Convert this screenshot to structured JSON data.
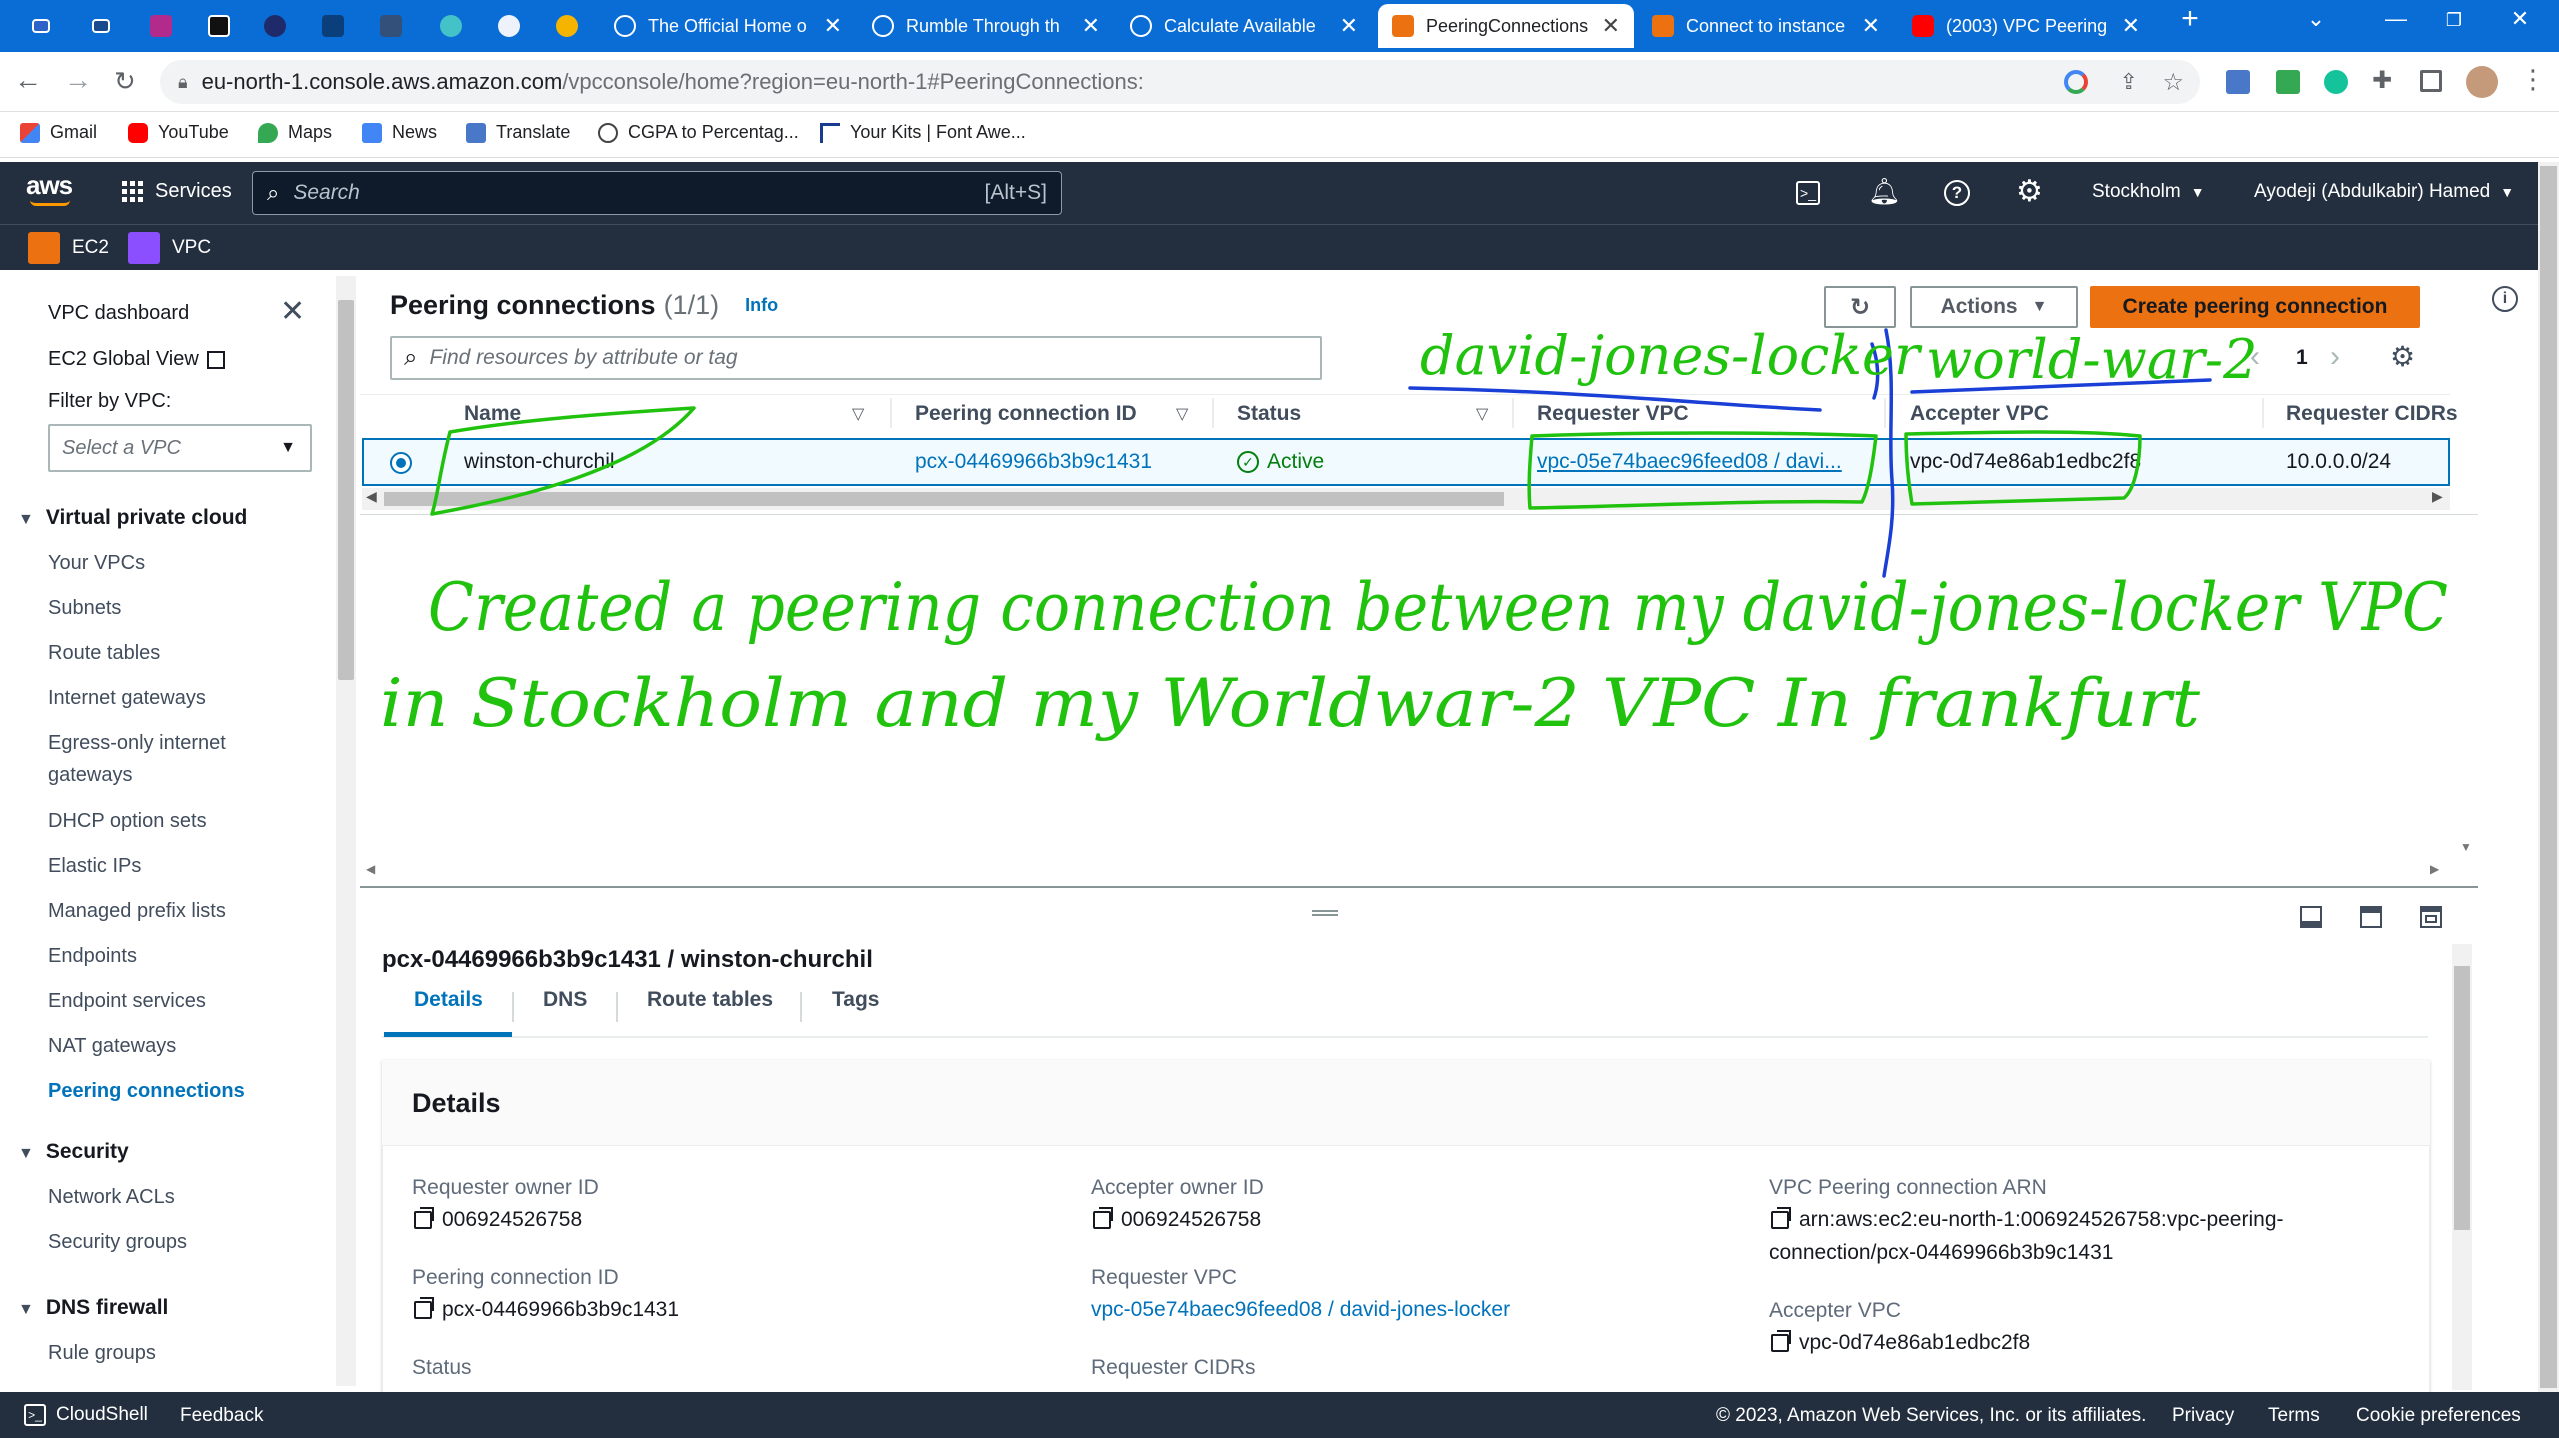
{
  "browser": {
    "tabs": [
      {
        "title": "The Official Home o",
        "active": false
      },
      {
        "title": "Rumble Through th",
        "active": false
      },
      {
        "title": "Calculate Available",
        "active": false
      },
      {
        "title": "PeeringConnections",
        "active": true
      },
      {
        "title": "Connect to instance",
        "active": false
      },
      {
        "title": "(2003) VPC Peering",
        "active": false
      }
    ],
    "url_host": "eu-north-1.console.aws.amazon.com",
    "url_path": "/vpcconsole/home?region=eu-north-1#PeeringConnections:",
    "bookmarks": [
      "Gmail",
      "YouTube",
      "Maps",
      "News",
      "Translate",
      "CGPA to Percentag...",
      "Your Kits | Font Awe..."
    ]
  },
  "aws": {
    "logo": "aws",
    "services_label": "Services",
    "search_placeholder": "Search",
    "search_shortcut": "[Alt+S]",
    "region": "Stockholm",
    "user": "Ayodeji (Abdulkabir) Hamed",
    "favorites": [
      "EC2",
      "VPC"
    ]
  },
  "sidebar": {
    "dashboard": "VPC dashboard",
    "global_view": "EC2 Global View",
    "filter_label": "Filter by VPC:",
    "filter_placeholder": "Select a VPC",
    "section_vpc": "Virtual private cloud",
    "vpc_items": [
      "Your VPCs",
      "Subnets",
      "Route tables",
      "Internet gateways",
      "Egress-only internet",
      "gateways",
      "DHCP option sets",
      "Elastic IPs",
      "Managed prefix lists",
      "Endpoints",
      "Endpoint services",
      "NAT gateways",
      "Peering connections"
    ],
    "section_security": "Security",
    "security_items": [
      "Network ACLs",
      "Security groups"
    ],
    "section_dns": "DNS firewall",
    "dns_items": [
      "Rule groups"
    ]
  },
  "main": {
    "title": "Peering connections",
    "count": "(1/1)",
    "info": "Info",
    "actions_label": "Actions",
    "create_label": "Create peering connection",
    "filter_placeholder": "Find resources by attribute or tag",
    "page_number": "1",
    "columns": [
      "Name",
      "Peering connection ID",
      "Status",
      "Requester VPC",
      "Accepter VPC",
      "Requester CIDRs"
    ],
    "row": {
      "name": "winston-churchil",
      "id": "pcx-04469966b3b9c1431",
      "status": "Active",
      "requester_vpc": "vpc-05e74baec96feed08 / davi...",
      "accepter_vpc": "vpc-0d74e86ab1edbc2f8",
      "requester_cidrs": "10.0.0.0/24"
    }
  },
  "detail": {
    "heading": "pcx-04469966b3b9c1431 / winston-churchil",
    "tabs": [
      "Details",
      "DNS",
      "Route tables",
      "Tags"
    ],
    "section_title": "Details",
    "requester_owner_label": "Requester owner ID",
    "requester_owner": "006924526758",
    "peering_id_label": "Peering connection ID",
    "peering_id": "pcx-04469966b3b9c1431",
    "status_label": "Status",
    "accepter_owner_label": "Accepter owner ID",
    "accepter_owner": "006924526758",
    "requester_vpc_label": "Requester VPC",
    "requester_vpc": "vpc-05e74baec96feed08 / david-jones-locker",
    "requester_cidrs_label": "Requester CIDRs",
    "arn_label": "VPC Peering connection ARN",
    "arn_line1": "arn:aws:ec2:eu-north-1:006924526758:vpc-peering-",
    "arn_line2": "connection/pcx-04469966b3b9c1431",
    "accepter_vpc_label": "Accepter VPC",
    "accepter_vpc": "vpc-0d74e86ab1edbc2f8"
  },
  "annotations": {
    "requester_name": "david-jones-locker",
    "accepter_name": "world-war-2",
    "note_line1": "Created a peering connection between my david-jones-locker VPC",
    "note_line2": "in Stockholm and my Worldwar-2 VPC In frankfurt",
    "color": "#20c20e"
  },
  "footer": {
    "cloudshell": "CloudShell",
    "feedback": "Feedback",
    "copyright": "© 2023, Amazon Web Services, Inc. or its affiliates.",
    "privacy": "Privacy",
    "terms": "Terms",
    "cookies": "Cookie preferences"
  },
  "colors": {
    "aws_header": "#232f3e",
    "chrome_blue": "#0a6dd6",
    "primary_button": "#ec7211",
    "link": "#0073bb",
    "active_status": "#037f0c"
  }
}
